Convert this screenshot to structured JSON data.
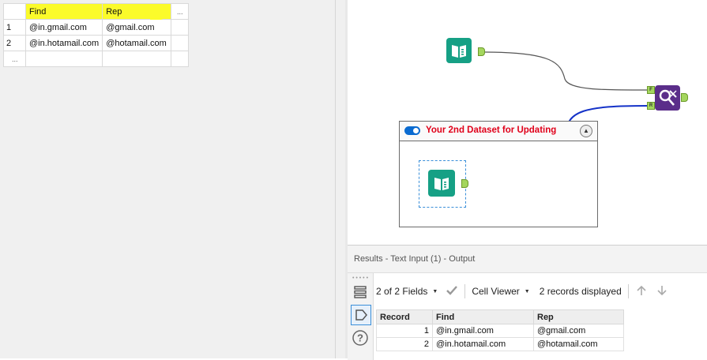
{
  "text_input": {
    "headers": [
      "Find",
      "Rep",
      "..."
    ],
    "rows": [
      {
        "num": "1",
        "find": "@in.gmail.com",
        "rep": "@gmail.com"
      },
      {
        "num": "2",
        "find": "@in.hotamail.com",
        "rep": "@hotamail.com"
      }
    ],
    "add_row_label": "...",
    "highlight_color": "#fbfb2a"
  },
  "canvas": {
    "container": {
      "title": "Your 2nd Dataset for Updating",
      "title_color": "#e0001a",
      "collapse_icon": "chevron-up-icon"
    },
    "tools": [
      {
        "name": "text-input-tool",
        "icon": "book-icon",
        "color": "#16a085"
      },
      {
        "name": "find-replace-tool",
        "icon": "find-replace-icon",
        "color": "#5b2e8a"
      },
      {
        "name": "text-input-tool-2",
        "icon": "book-icon",
        "color": "#16a085"
      }
    ],
    "anchors": {
      "find": "F",
      "replace": "R"
    }
  },
  "results": {
    "title": "Results - Text Input (1) - Output",
    "fields_label": "2 of 2 Fields",
    "viewer_label": "Cell Viewer",
    "records_label": "2 records displayed",
    "headers": [
      "Record",
      "Find",
      "Rep"
    ],
    "rows": [
      {
        "record": "1",
        "find": "@in.gmail.com",
        "rep": "@gmail.com"
      },
      {
        "record": "2",
        "find": "@in.hotamail.com",
        "rep": "@hotamail.com"
      }
    ]
  }
}
